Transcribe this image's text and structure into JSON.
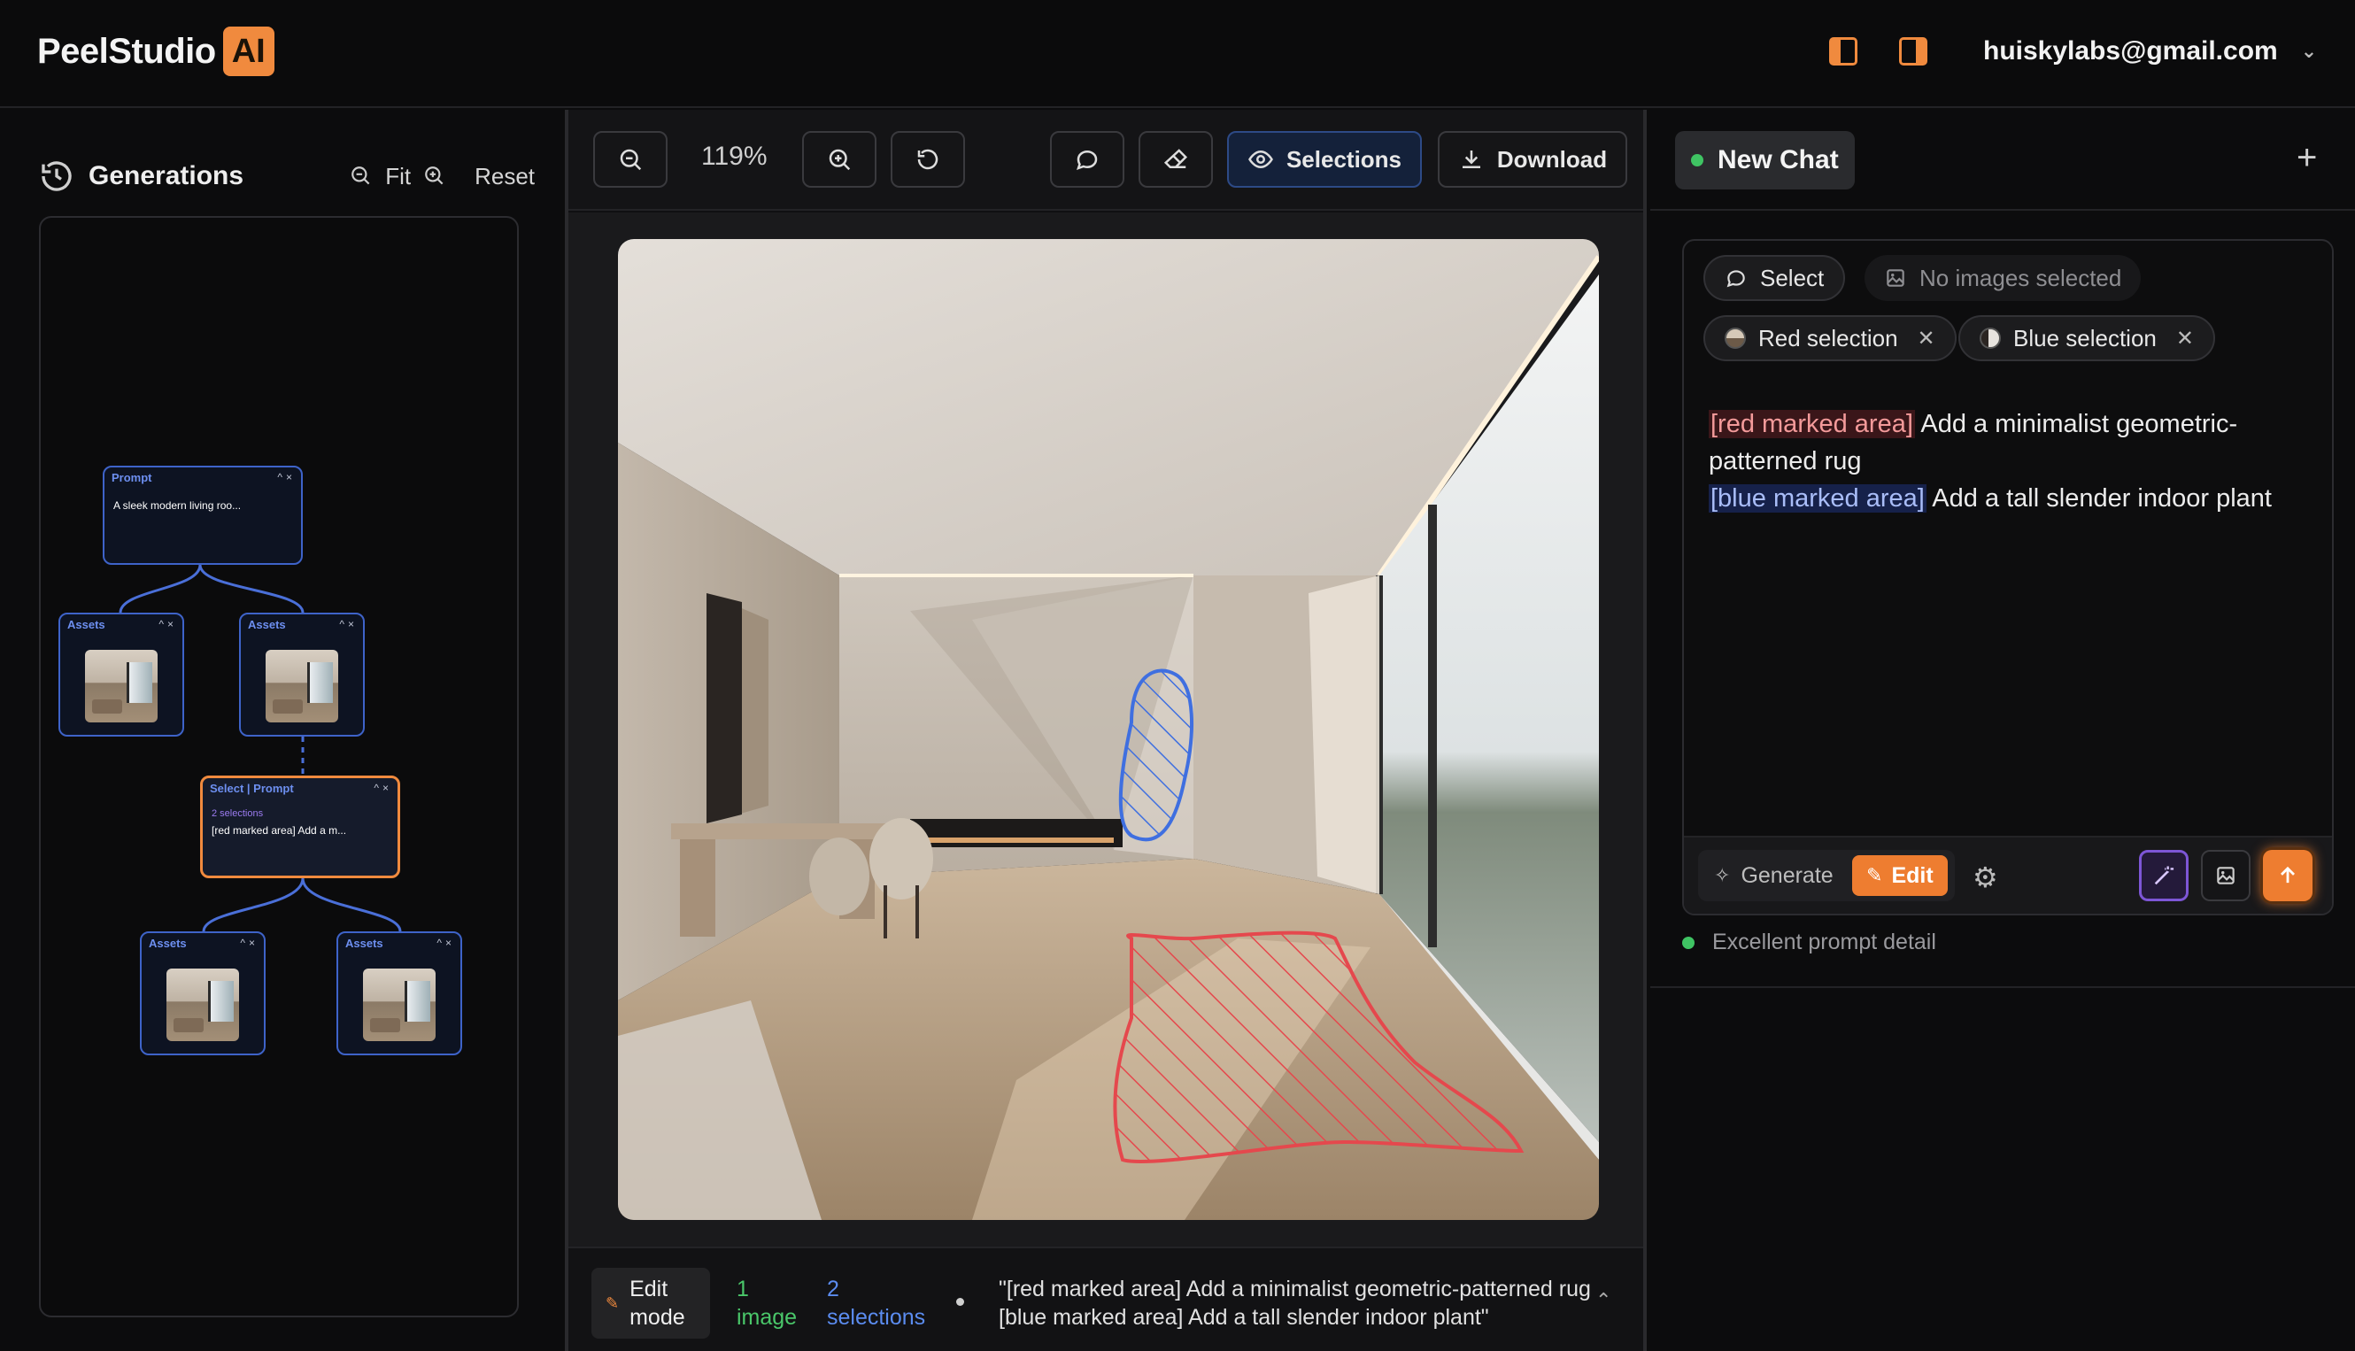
{
  "app": {
    "name": "PeelStudio",
    "badge": "AI"
  },
  "header": {
    "account_email": "huiskylabs@gmail.com"
  },
  "left_panel": {
    "title": "Generations",
    "fit_label": "Fit",
    "reset_label": "Reset",
    "tree": {
      "prompt_node": {
        "header": "Prompt",
        "text": "A sleek modern living roo..."
      },
      "assets_node_label": "Assets",
      "select_node": {
        "header": "Select | Prompt",
        "selections": "2 selections",
        "text": "[red marked area] Add a m..."
      }
    }
  },
  "toolbar": {
    "zoom_level": "119%",
    "selections_label": "Selections",
    "download_label": "Download"
  },
  "status": {
    "mode_label": "Edit mode",
    "image_count": "1 image",
    "selection_count": "2 selections",
    "prompt_preview": "\"[red marked area] Add a minimalist geometric-patterned rug [blue marked area] Add a tall slender indoor plant\""
  },
  "chat": {
    "title": "New Chat",
    "select_label": "Select",
    "no_images_label": "No images selected",
    "chips": [
      "Red selection",
      "Blue selection"
    ],
    "prompt": {
      "red_tag": "[red marked area]",
      "red_text": "Add a minimalist geometric-patterned rug",
      "blue_tag": "[blue marked area]",
      "blue_text": "Add a tall slender indoor plant"
    },
    "modes": {
      "generate": "Generate",
      "edit": "Edit"
    },
    "quality": "Excellent prompt detail"
  },
  "colors": {
    "accent": "#ee7d30",
    "selection_red": "#e5484d",
    "selection_blue": "#3f6fe0",
    "ok_green": "#3fc463"
  }
}
